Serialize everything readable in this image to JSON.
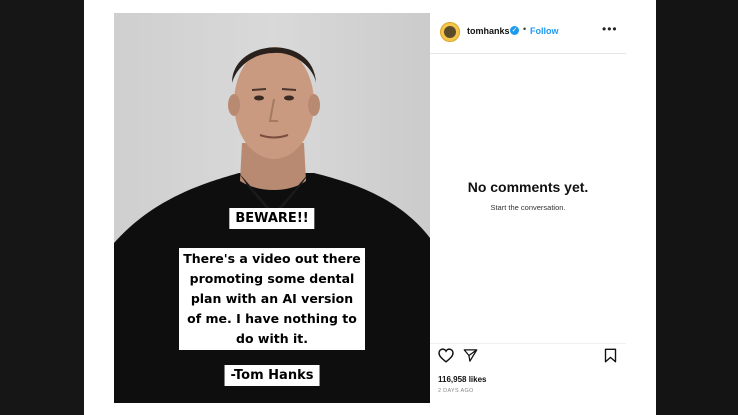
{
  "post": {
    "caption": {
      "beware": "BEWARE!!",
      "line1": "There's a video out there",
      "line2": "promoting some dental",
      "line3": "plan with an AI version",
      "line4": "of me.  I have nothing to",
      "line5": "do with it.",
      "signature": "-Tom Hanks"
    }
  },
  "header": {
    "username": "tomhanks",
    "verified_mark": "✓",
    "separator": "•",
    "follow_label": "Follow",
    "more_label": "•••"
  },
  "comments": {
    "empty_title": "No comments yet.",
    "empty_subtitle": "Start the conversation."
  },
  "footer": {
    "likes": "116,958 likes",
    "date": "2 DAYS AGO"
  },
  "icons": {
    "like": "heart-icon",
    "share": "send-icon",
    "save": "bookmark-icon",
    "verified": "verified-badge-icon"
  },
  "colors": {
    "accent": "#1d9bf0",
    "background": "#111111",
    "card": "#ffffff"
  }
}
